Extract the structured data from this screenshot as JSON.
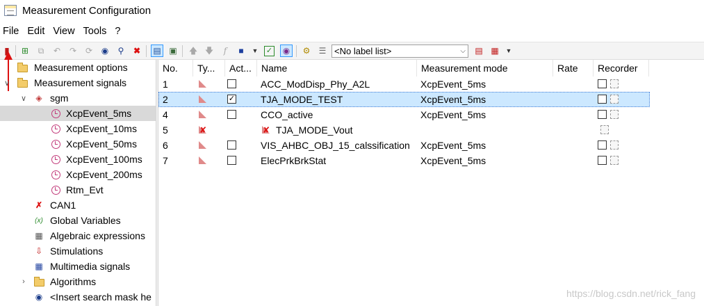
{
  "window": {
    "title": "Measurement Configuration"
  },
  "menubar": {
    "items": [
      "File",
      "Edit",
      "View",
      "Tools",
      "?"
    ]
  },
  "toolbar": {
    "label_list": "<No label list>",
    "buttons": [
      "start-measurement-icon",
      "add-icon",
      "copy-icon",
      "undo-icon",
      "redo-icon",
      "move-icon",
      "find-icon",
      "search-icon",
      "delete-icon",
      "config-icon",
      "image-icon",
      "move-up-icon",
      "move-down-icon",
      "function-icon",
      "save-icon",
      "check-icon",
      "user-icon",
      "new-label-icon",
      "list-icon",
      "export-icon",
      "import-icon"
    ]
  },
  "tree": {
    "items": [
      {
        "label": "Measurement options",
        "icon": "folder-icon",
        "expander": ""
      },
      {
        "label": "Measurement signals",
        "icon": "folder-icon",
        "expander": "v"
      },
      {
        "label": "sgm",
        "icon": "device-icon",
        "expander": "v"
      },
      {
        "label": "XcpEvent_5ms",
        "icon": "clock-icon",
        "selected": true
      },
      {
        "label": "XcpEvent_10ms",
        "icon": "clock-icon"
      },
      {
        "label": "XcpEvent_50ms",
        "icon": "clock-icon"
      },
      {
        "label": "XcpEvent_100ms",
        "icon": "clock-icon"
      },
      {
        "label": "XcpEvent_200ms",
        "icon": "clock-icon"
      },
      {
        "label": "Rtm_Evt",
        "icon": "clock-icon"
      },
      {
        "label": "CAN1",
        "icon": "can-icon"
      },
      {
        "label": "Global Variables",
        "icon": "variable-icon"
      },
      {
        "label": "Algebraic expressions",
        "icon": "expression-icon"
      },
      {
        "label": "Stimulations",
        "icon": "stimulation-icon"
      },
      {
        "label": "Multimedia signals",
        "icon": "multimedia-icon"
      },
      {
        "label": "Algorithms",
        "icon": "folder-icon",
        "expander": ">"
      },
      {
        "label": "<Insert search mask he",
        "icon": "binoculars-icon"
      }
    ]
  },
  "grid": {
    "columns": [
      "No.",
      "Ty...",
      "Act...",
      "Name",
      "Measurement mode",
      "Rate",
      "Recorder"
    ],
    "rows": [
      {
        "no": "1",
        "active": false,
        "name": "ACC_ModDisp_Phy_A2L",
        "mode": "XcpEvent_5ms",
        "rate": "",
        "recorder": true
      },
      {
        "no": "2",
        "active": true,
        "name": "TJA_MODE_TEST",
        "mode": "XcpEvent_5ms",
        "rate": "",
        "recorder": true,
        "selected": true
      },
      {
        "no": "4",
        "active": false,
        "name": "CCO_active",
        "mode": "XcpEvent_5ms",
        "rate": "",
        "recorder": true
      },
      {
        "no": "5",
        "error": true,
        "name": "TJA_MODE_Vout",
        "mode": "",
        "rate": "",
        "recorder": false
      },
      {
        "no": "6",
        "active": false,
        "name": "VIS_AHBC_OBJ_15_calssification",
        "mode": "XcpEvent_5ms",
        "rate": "",
        "recorder": true
      },
      {
        "no": "7",
        "active": false,
        "name": "ElecPrkBrkStat",
        "mode": "XcpEvent_5ms",
        "rate": "",
        "recorder": true
      }
    ]
  },
  "watermark": "https://blog.csdn.net/rick_fang",
  "colors": {
    "selection": "#cce8ff",
    "tree_selected": "#d9d9d9",
    "annotation_arrow": "#dd1111"
  }
}
